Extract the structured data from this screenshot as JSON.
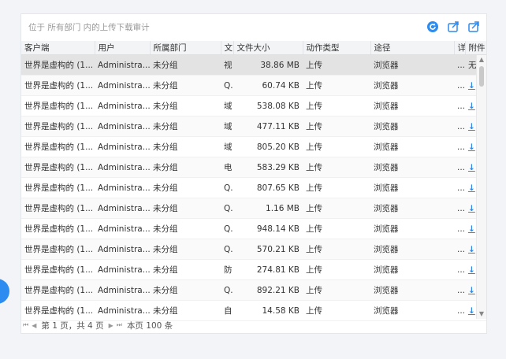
{
  "header": {
    "title": "位于 所有部门 内的上传下载审计"
  },
  "columns": [
    "客户端",
    "用户",
    "所属部门",
    "文",
    "文件大小",
    "动作类型",
    "途径",
    "详",
    "附件"
  ],
  "rows": [
    {
      "client": "世界是虚构的 (1...",
      "user": "Administra...",
      "dept": "未分组",
      "file": "视",
      "size": "38.86 MB",
      "action": "上传",
      "route": "浏览器",
      "detail": "...",
      "attach": "无"
    },
    {
      "client": "世界是虚构的 (1...",
      "user": "Administra...",
      "dept": "未分组",
      "file": "Q.",
      "size": "60.74 KB",
      "action": "上传",
      "route": "浏览器",
      "detail": "...",
      "attach": "↓"
    },
    {
      "client": "世界是虚构的 (1...",
      "user": "Administra...",
      "dept": "未分组",
      "file": "域",
      "size": "538.08 KB",
      "action": "上传",
      "route": "浏览器",
      "detail": "...",
      "attach": "↓"
    },
    {
      "client": "世界是虚构的 (1...",
      "user": "Administra...",
      "dept": "未分组",
      "file": "域",
      "size": "477.11 KB",
      "action": "上传",
      "route": "浏览器",
      "detail": "...",
      "attach": "↓"
    },
    {
      "client": "世界是虚构的 (1...",
      "user": "Administra...",
      "dept": "未分组",
      "file": "域",
      "size": "805.20 KB",
      "action": "上传",
      "route": "浏览器",
      "detail": "...",
      "attach": "↓"
    },
    {
      "client": "世界是虚构的 (1...",
      "user": "Administra...",
      "dept": "未分组",
      "file": "电",
      "size": "583.29 KB",
      "action": "上传",
      "route": "浏览器",
      "detail": "...",
      "attach": "↓"
    },
    {
      "client": "世界是虚构的 (1...",
      "user": "Administra...",
      "dept": "未分组",
      "file": "Q.",
      "size": "807.65 KB",
      "action": "上传",
      "route": "浏览器",
      "detail": "...",
      "attach": "↓"
    },
    {
      "client": "世界是虚构的 (1...",
      "user": "Administra...",
      "dept": "未分组",
      "file": "Q.",
      "size": "1.16 MB",
      "action": "上传",
      "route": "浏览器",
      "detail": "...",
      "attach": "↓"
    },
    {
      "client": "世界是虚构的 (1...",
      "user": "Administra...",
      "dept": "未分组",
      "file": "Q.",
      "size": "948.14 KB",
      "action": "上传",
      "route": "浏览器",
      "detail": "...",
      "attach": "↓"
    },
    {
      "client": "世界是虚构的 (1...",
      "user": "Administra...",
      "dept": "未分组",
      "file": "Q.",
      "size": "570.21 KB",
      "action": "上传",
      "route": "浏览器",
      "detail": "...",
      "attach": "↓"
    },
    {
      "client": "世界是虚构的 (1...",
      "user": "Administra...",
      "dept": "未分组",
      "file": "防",
      "size": "274.81 KB",
      "action": "上传",
      "route": "浏览器",
      "detail": "...",
      "attach": "↓"
    },
    {
      "client": "世界是虚构的 (1...",
      "user": "Administra...",
      "dept": "未分组",
      "file": "Q.",
      "size": "892.21 KB",
      "action": "上传",
      "route": "浏览器",
      "detail": "...",
      "attach": "↓"
    },
    {
      "client": "世界是虚构的 (1...",
      "user": "Administra...",
      "dept": "未分组",
      "file": "自",
      "size": "14.58 KB",
      "action": "上传",
      "route": "浏览器",
      "detail": "...",
      "attach": "↓"
    }
  ],
  "pager": {
    "text": "第 1 页，共 4 页",
    "total": "本页 100 条"
  },
  "icons": {
    "refresh": "refresh-icon",
    "export": "export-icon",
    "export_all": "export-all-icon"
  },
  "colors": {
    "accent": "#2d8cf0",
    "selected_row": "#e3e3e3"
  }
}
